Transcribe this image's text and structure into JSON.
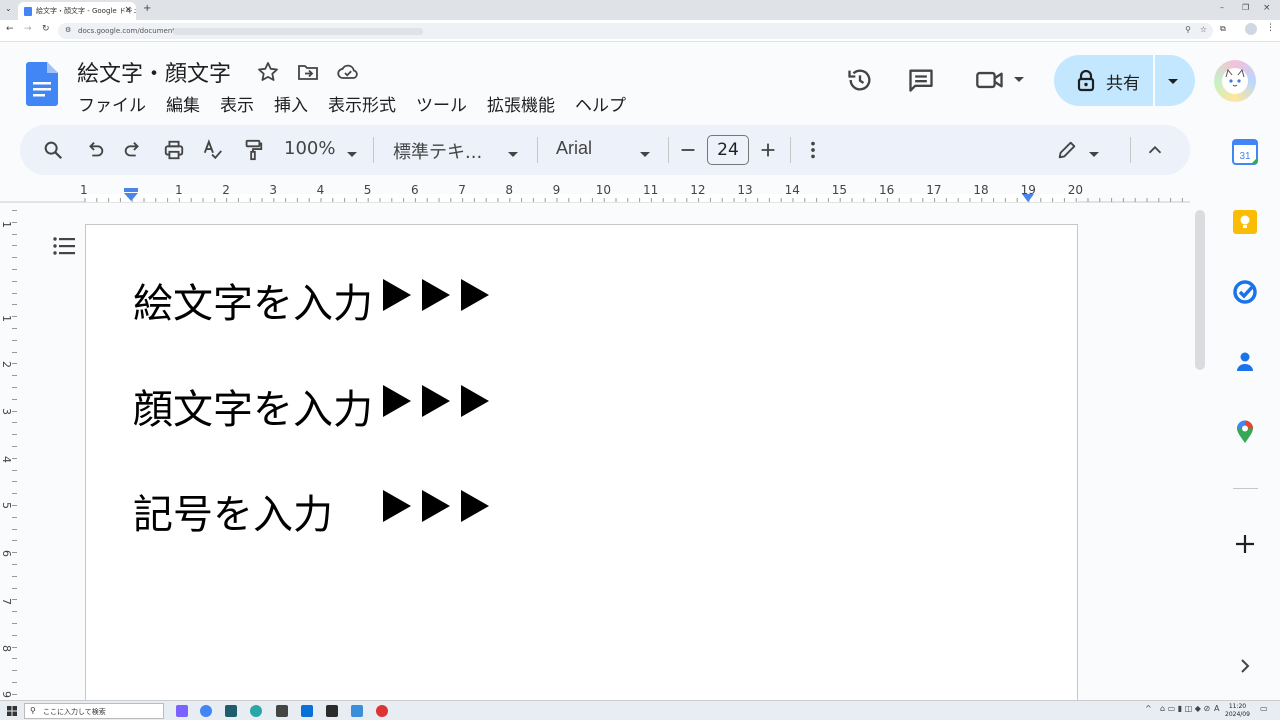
{
  "browser": {
    "tab_title": "絵文字・顔文字 - Google ドキュメ",
    "url": "docs.google.com/document/"
  },
  "doc": {
    "title": "絵文字・顔文字",
    "menus": [
      "ファイル",
      "編集",
      "表示",
      "挿入",
      "表示形式",
      "ツール",
      "拡張機能",
      "ヘルプ"
    ],
    "share_label": "共有"
  },
  "toolbar": {
    "zoom": "100%",
    "style": "標準テキ...",
    "font": "Arial",
    "font_size": "24"
  },
  "ruler": {
    "h_numbers": [
      "1",
      "1",
      "2",
      "3",
      "4",
      "5",
      "6",
      "7",
      "8",
      "9",
      "10",
      "11",
      "12",
      "13",
      "14",
      "15",
      "16",
      "17",
      "18",
      "19",
      "20"
    ],
    "v_numbers": [
      "1",
      "1",
      "2",
      "3",
      "4",
      "5",
      "6",
      "7",
      "8",
      "9"
    ]
  },
  "content": {
    "lines": [
      "絵文字を入力",
      "顔文字を入力",
      "記号を入力"
    ]
  },
  "side_panel": {
    "calendar_day": "31"
  },
  "taskbar": {
    "search_placeholder": "ここに入力して検索",
    "time": "11:20",
    "date": "2024/09"
  },
  "colors": {
    "docs_blue": "#4285f4",
    "share_bg": "#c2e7ff",
    "toolbar_bg": "#edf2fa"
  }
}
